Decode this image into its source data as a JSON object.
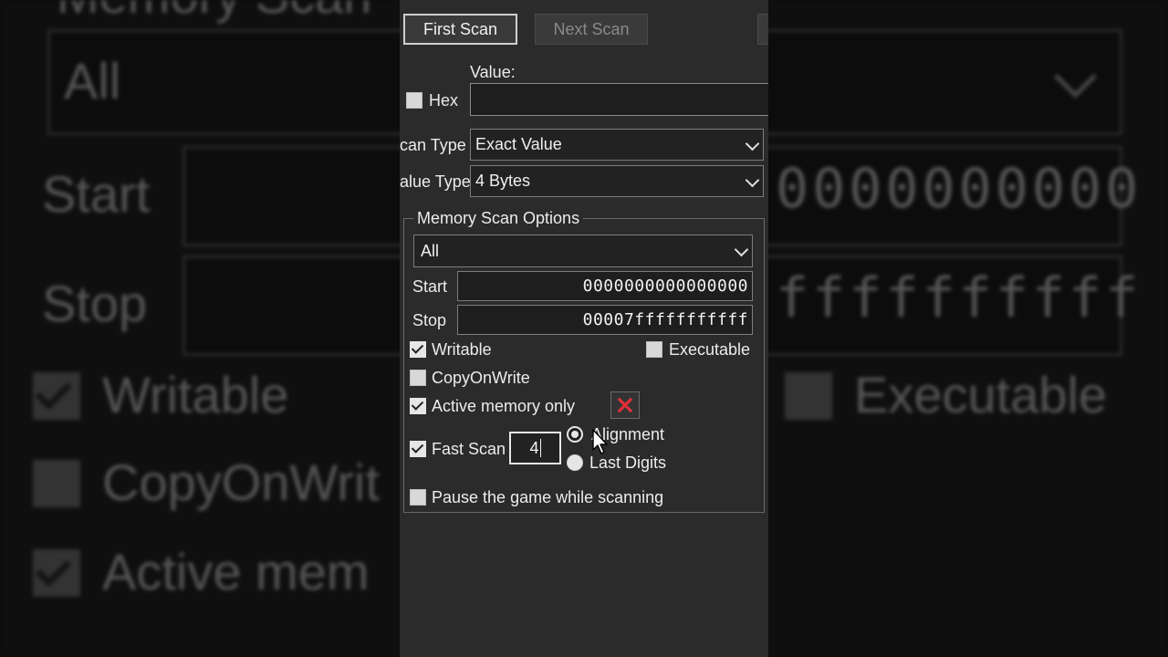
{
  "background": {
    "partial_title": "Memory Scan",
    "select_value": "All",
    "start_label": "Start",
    "start_value_partial": "0000000000",
    "stop_label": "Stop",
    "stop_value_partial": "ffffffffff",
    "writable_label": "Writable",
    "executable_label": "Executable",
    "copyonwrite_partial": "CopyOnWrit",
    "active_partial": "Active mem"
  },
  "toolbar": {
    "first_scan": "First Scan",
    "next_scan": "Next Scan"
  },
  "value": {
    "label": "Value:",
    "hex_label": "Hex",
    "hex_checked": false,
    "input_value": ""
  },
  "scan_type": {
    "label": "can Type",
    "selected": "Exact Value"
  },
  "value_type": {
    "label": "alue Type",
    "selected": "4 Bytes"
  },
  "memory_scan_options": {
    "title": "Memory Scan Options",
    "region_selected": "All",
    "start_label": "Start",
    "start_value": "0000000000000000",
    "stop_label": "Stop",
    "stop_value": "00007fffffffffff",
    "writable": {
      "label": "Writable",
      "checked": true
    },
    "executable": {
      "label": "Executable",
      "checked": false
    },
    "copyonwrite": {
      "label": "CopyOnWrite",
      "checked": false
    },
    "active_memory_only": {
      "label": "Active memory only",
      "checked": true
    },
    "fast_scan": {
      "label": "Fast Scan",
      "checked": true,
      "value": "4"
    },
    "alignment": {
      "label": "Alignment",
      "selected": true
    },
    "last_digits": {
      "label": "Last Digits",
      "selected": false
    },
    "pause_game": {
      "label": "Pause the game while scanning",
      "checked": false
    }
  },
  "colors": {
    "panel_bg": "#2b2b2b",
    "close_x": "#e0303a"
  },
  "icons": {
    "dropdown": "chevron-down-icon",
    "clear": "close-icon",
    "pointer": "mouse-cursor-icon"
  }
}
